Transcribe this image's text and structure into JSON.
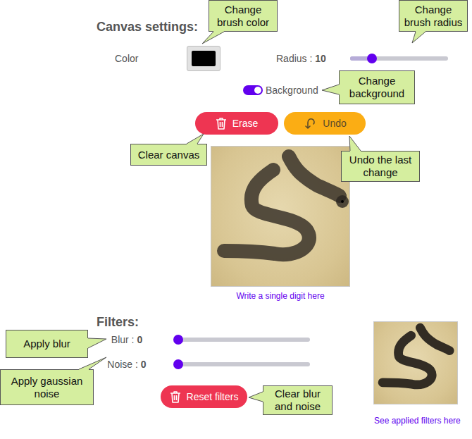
{
  "canvas_settings": {
    "title": "Canvas settings:",
    "color": {
      "label": "Color",
      "value": "#000000"
    },
    "radius": {
      "label": "Radius :",
      "reading": "10",
      "level": 0.22
    },
    "background": {
      "label": "Background",
      "on": true
    },
    "buttons": [
      {
        "label": "Erase",
        "kind": "erase"
      },
      {
        "label": "Undo",
        "kind": "undo"
      }
    ]
  },
  "canvas": {
    "caption": "Write a single digit here"
  },
  "filters": {
    "title": "Filters:",
    "sliders": [
      {
        "label": "Blur :",
        "reading": "0",
        "level": 0
      },
      {
        "label": "Noise :",
        "reading": "0",
        "level": 0
      }
    ],
    "reset": {
      "label": "Reset filters"
    }
  },
  "preview": {
    "caption": "See applied filters here"
  },
  "callouts": [
    {
      "text": "Change brush color"
    },
    {
      "text": "Change brush radius"
    },
    {
      "text": "Change background"
    },
    {
      "text": "Clear canvas"
    },
    {
      "text": "Undo the last change"
    },
    {
      "text": "Apply blur"
    },
    {
      "text": "Apply gaussian noise"
    },
    {
      "text": "Clear blur and noise"
    }
  ]
}
